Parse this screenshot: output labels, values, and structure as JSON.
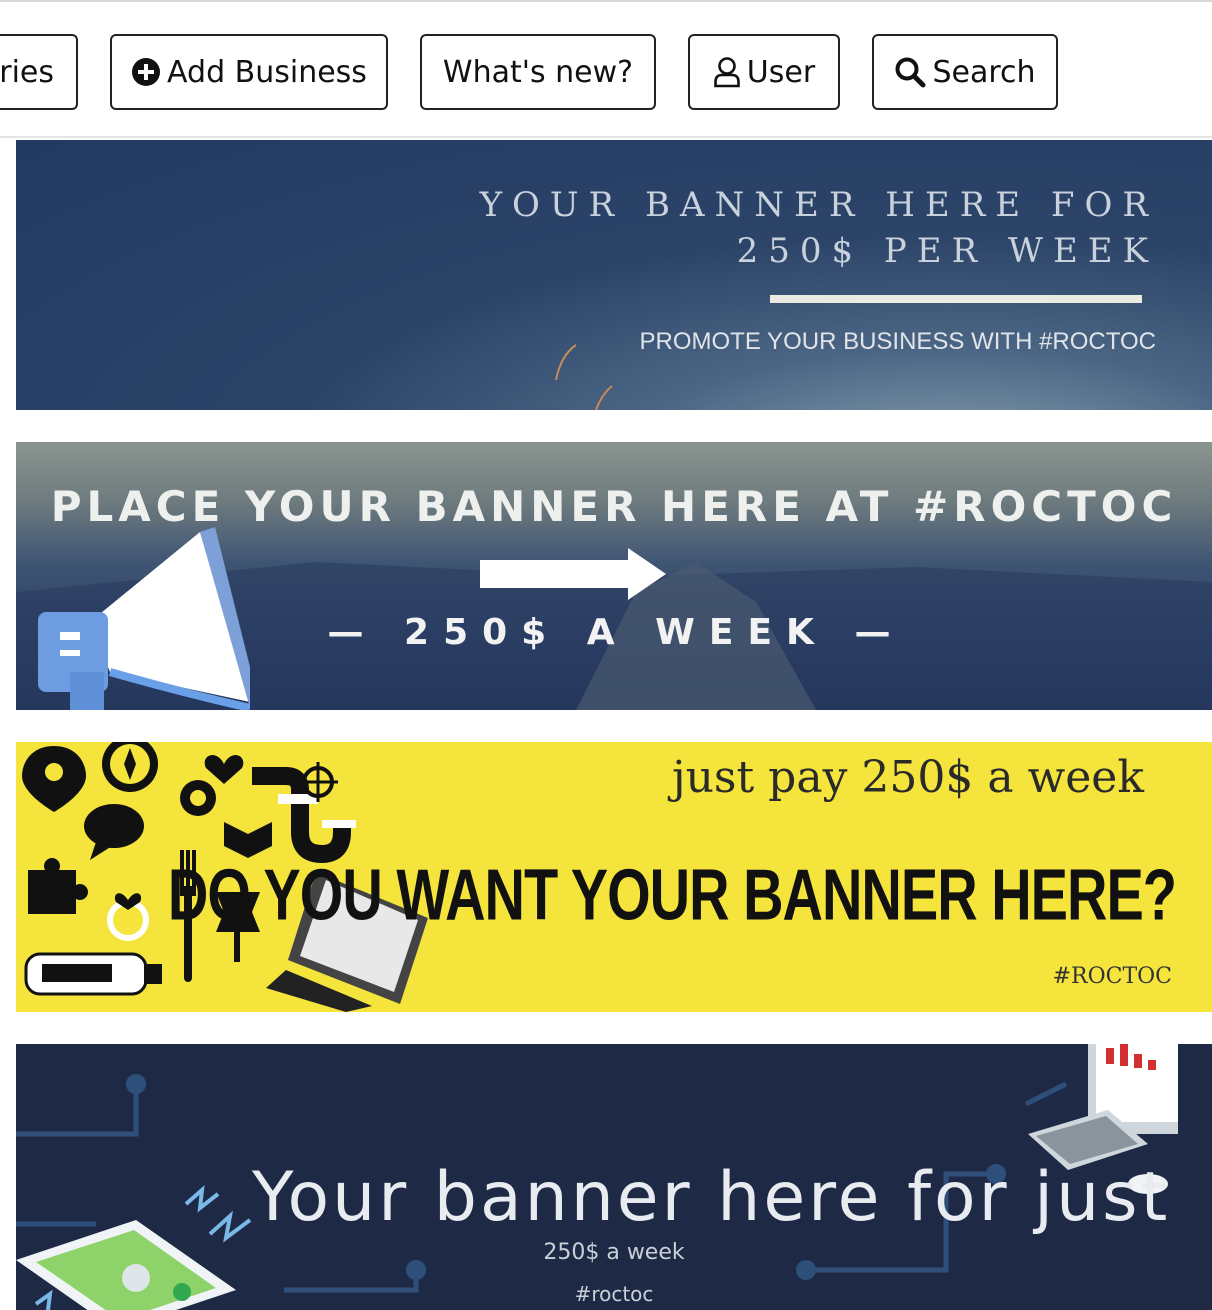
{
  "nav": {
    "categories_label": "ries",
    "add_business_label": "Add Business",
    "whats_new_label": "What's new?",
    "user_label": "User",
    "search_label": "Search"
  },
  "banners": [
    {
      "headline_line1": "YOUR BANNER HERE FOR",
      "headline_line2": "250$ PER WEEK",
      "subline": "PROMOTE YOUR BUSINESS WITH #ROCTOC"
    },
    {
      "headline": "PLACE YOUR BANNER HERE AT #ROCTOC",
      "subline": "— 250$ A WEEK —"
    },
    {
      "top_line": "just pay 250$ a week",
      "headline": "DO YOU WANT YOUR BANNER HERE?",
      "hashtag": "#ROCTOC"
    },
    {
      "headline": "Your banner here for just",
      "price": "250$ a week",
      "hashtag": "#roctoc"
    }
  ],
  "colors": {
    "banner1_bg": "#223a62",
    "banner2_bg": "#2e4166",
    "banner3_bg": "#f4e43c",
    "banner4_bg": "#1e2a45"
  },
  "icons": {
    "add_business": "plus-circle-icon",
    "user": "user-icon",
    "search": "search-icon",
    "banner2": "megaphone-icon",
    "banner4": [
      "computer-icon",
      "phone-icon"
    ]
  }
}
